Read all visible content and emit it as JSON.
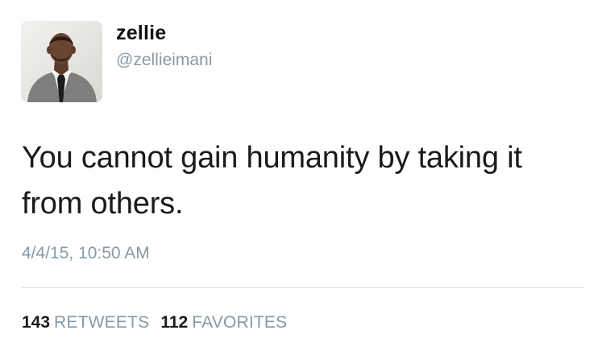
{
  "user": {
    "display_name": "zellie",
    "handle": "@zellieimani"
  },
  "tweet": {
    "text": "You cannot gain humanity by taking it from others.",
    "timestamp": "4/4/15, 10:50 AM"
  },
  "stats": {
    "retweets_count": "143",
    "retweets_label": "RETWEETS",
    "favorites_count": "112",
    "favorites_label": "FAVORITES"
  }
}
